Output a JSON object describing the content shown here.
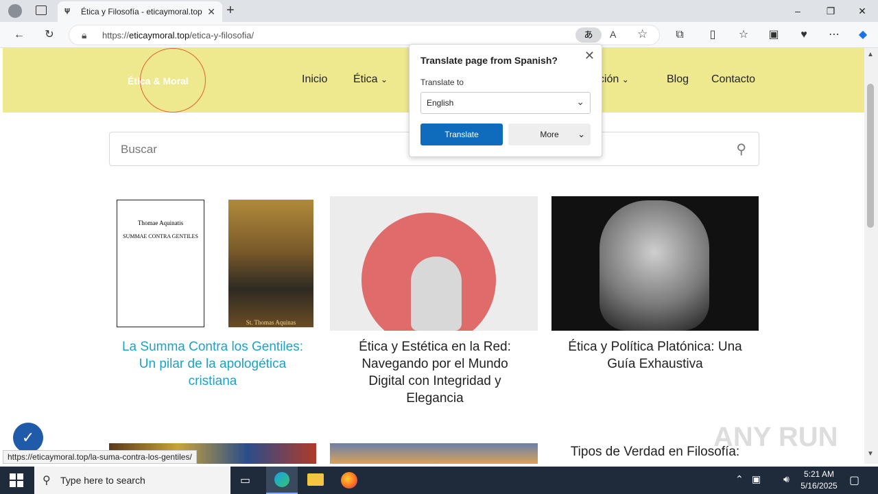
{
  "browser": {
    "tab_title": "Ética y Filosofía - eticaymoral.top",
    "url_prefix": "https://",
    "url_domain": "eticaymoral.top",
    "url_path": "/etica-y-filosofia/"
  },
  "site": {
    "logo_text": "Ética & Moral",
    "nav": [
      "Inicio",
      "Ética",
      "ación",
      "Blog",
      "Contacto"
    ],
    "search_placeholder": "Buscar"
  },
  "translate_popup": {
    "title": "Translate page from Spanish?",
    "translate_to_label": "Translate to",
    "language": "English",
    "translate_button": "Translate",
    "more_button": "More"
  },
  "posts": [
    {
      "title": "La Summa Contra los Gentiles: Un pilar de la apologética cristiana",
      "image_alt": "Thomae Aquinatis Summae Contra Gentiles book cover with St. Thomas Aquinas icon",
      "book_line1": "Thomae Aquinatis",
      "book_line2": "SUMMAE CONTRA GENTILES",
      "icon_caption": "St. Thomas Aquinas"
    },
    {
      "title": "Ética y Estética en la Red: Navegando por el Mundo Digital con Integridad y Elegancia"
    },
    {
      "title": "Ética y Política Platónica: Una Guía Exhaustiva"
    },
    {
      "title": "Tipos de Verdad en Filosofía:"
    }
  ],
  "status_url": "https://eticaymoral.top/la-suma-contra-los-gentiles/",
  "taskbar": {
    "search_placeholder": "Type here to search",
    "time": "5:21 AM",
    "date": "5/16/2025"
  },
  "watermark": "ANY RUN",
  "colors": {
    "header_bg": "#eee98f",
    "accent_link": "#1aa3c9",
    "translate_btn": "#0f6cbd"
  }
}
